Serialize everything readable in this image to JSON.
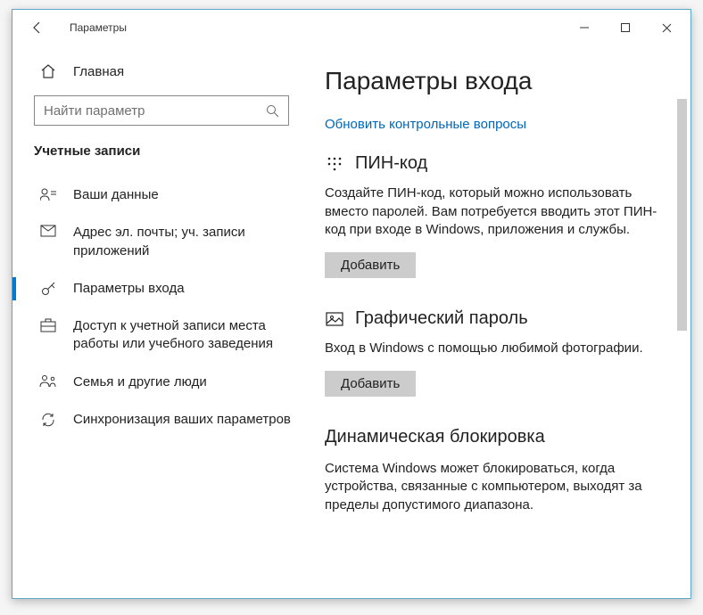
{
  "titlebar": {
    "title": "Параметры"
  },
  "sidebar": {
    "home": "Главная",
    "search_placeholder": "Найти параметр",
    "section": "Учетные записи",
    "items": [
      {
        "label": "Ваши данные"
      },
      {
        "label": "Адрес эл. почты; уч. записи приложений"
      },
      {
        "label": "Параметры входа"
      },
      {
        "label": "Доступ к учетной записи места работы или учебного заведения"
      },
      {
        "label": "Семья и другие люди"
      },
      {
        "label": "Синхронизация ваших параметров"
      }
    ]
  },
  "main": {
    "heading": "Параметры входа",
    "update_link": "Обновить контрольные вопросы",
    "pin": {
      "title": "ПИН-код",
      "desc": "Создайте ПИН-код, который можно использовать вместо паролей. Вам потребуется вводить этот ПИН-код при входе в Windows, приложения и службы.",
      "button": "Добавить"
    },
    "picture": {
      "title": "Графический пароль",
      "desc": "Вход в Windows с помощью любимой фотографии.",
      "button": "Добавить"
    },
    "dynamic": {
      "title": "Динамическая блокировка",
      "desc": "Система Windows может блокироваться, когда устройства, связанные с компьютером, выходят за пределы допустимого диапазона."
    }
  }
}
